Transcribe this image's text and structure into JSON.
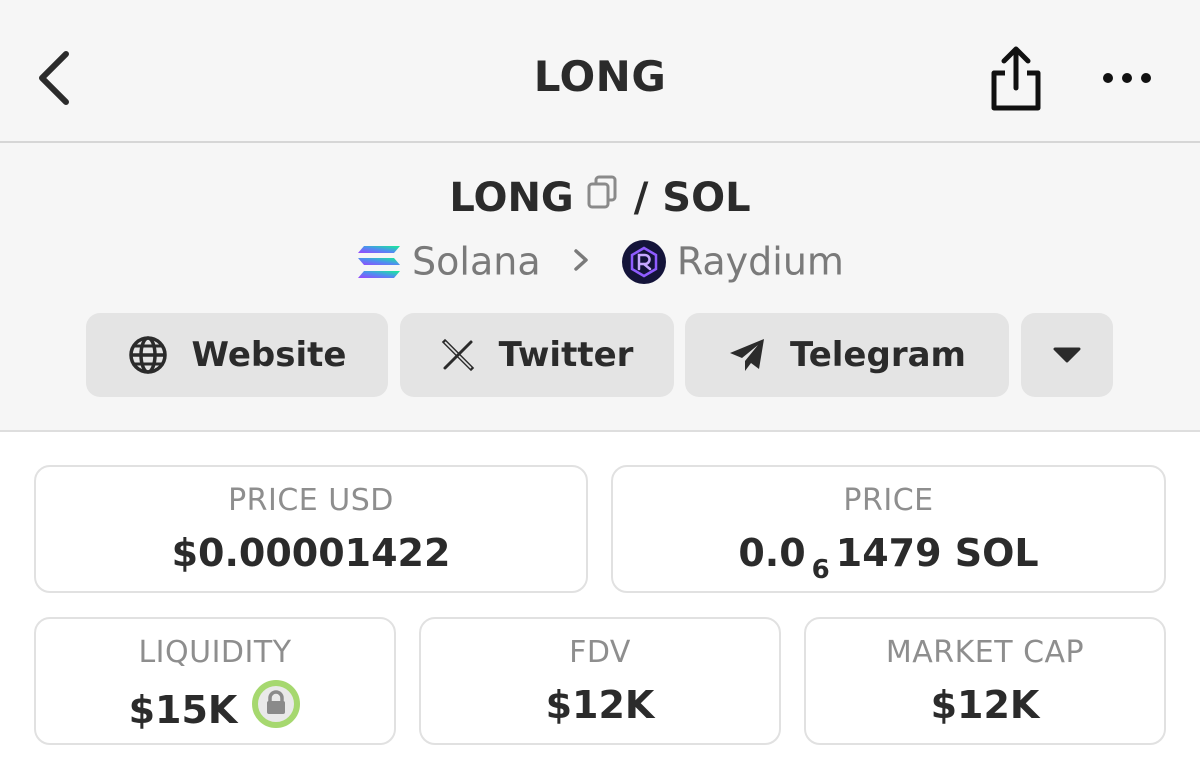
{
  "header": {
    "title": "LONG"
  },
  "pair": {
    "base": "LONG",
    "separator": "/",
    "quote": "SOL"
  },
  "chain": {
    "network": "Solana",
    "dex": "Raydium"
  },
  "links": [
    {
      "label": "Website",
      "icon": "globe-icon"
    },
    {
      "label": "Twitter",
      "icon": "x-logo-icon"
    },
    {
      "label": "Telegram",
      "icon": "telegram-icon"
    }
  ],
  "stats": {
    "price_usd": {
      "label": "PRICE USD",
      "value": "$0.00001422"
    },
    "price": {
      "label": "PRICE",
      "value_prefix": "0.0",
      "value_zeros": "6",
      "value_suffix": "1479 SOL"
    },
    "liquidity": {
      "label": "LIQUIDITY",
      "value": "$15K",
      "icon": "lock-icon"
    },
    "fdv": {
      "label": "FDV",
      "value": "$12K"
    },
    "market_cap": {
      "label": "MARKET CAP",
      "value": "$12K"
    }
  },
  "colors": {
    "lock_ring": "#a6d86f",
    "raydium_bg": "#14143a",
    "raydium_accent": "#8f5cff"
  }
}
